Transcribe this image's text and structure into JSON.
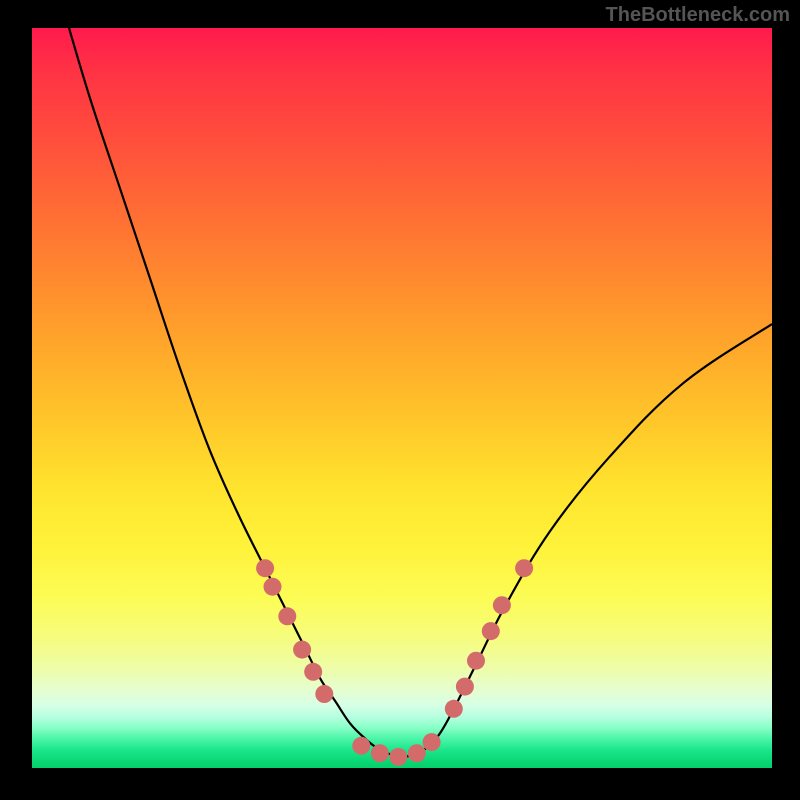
{
  "watermark": "TheBottleneck.com",
  "chart_data": {
    "type": "line",
    "title": "",
    "xlabel": "",
    "ylabel": "",
    "xlim": [
      0,
      100
    ],
    "ylim": [
      0,
      100
    ],
    "curve": {
      "x": [
        5,
        8,
        12,
        16,
        20,
        24,
        28,
        32,
        35,
        37,
        39,
        41,
        43,
        45,
        47,
        50,
        53,
        55,
        57,
        60,
        64,
        70,
        78,
        88,
        100
      ],
      "y": [
        100,
        90,
        78,
        66,
        54,
        43,
        34,
        26,
        20,
        16,
        12,
        9,
        6,
        4,
        2.5,
        1.5,
        2.5,
        4.5,
        8,
        14,
        22,
        32,
        42,
        52,
        60
      ]
    },
    "points": [
      {
        "x": 31.5,
        "y": 27
      },
      {
        "x": 32.5,
        "y": 24.5
      },
      {
        "x": 34.5,
        "y": 20.5
      },
      {
        "x": 36.5,
        "y": 16
      },
      {
        "x": 38,
        "y": 13
      },
      {
        "x": 39.5,
        "y": 10
      },
      {
        "x": 44.5,
        "y": 3
      },
      {
        "x": 47,
        "y": 2
      },
      {
        "x": 49.5,
        "y": 1.5
      },
      {
        "x": 52,
        "y": 2
      },
      {
        "x": 54,
        "y": 3.5
      },
      {
        "x": 57,
        "y": 8
      },
      {
        "x": 58.5,
        "y": 11
      },
      {
        "x": 60,
        "y": 14.5
      },
      {
        "x": 62,
        "y": 18.5
      },
      {
        "x": 63.5,
        "y": 22
      },
      {
        "x": 66.5,
        "y": 27
      }
    ],
    "colors": {
      "curve": "#000000",
      "points": "#d36b6b",
      "gradient_top": "#ff1a4d",
      "gradient_bottom": "#05d06b"
    }
  }
}
